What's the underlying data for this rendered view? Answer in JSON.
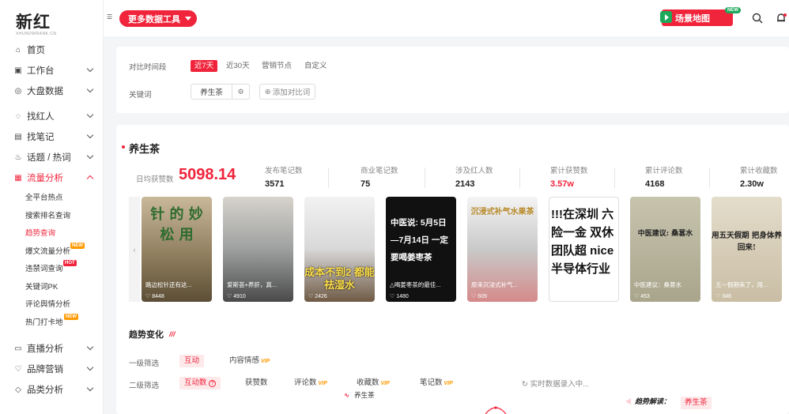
{
  "logo": {
    "main": "新红",
    "sub": "XHUNDWRANK.CN"
  },
  "sidebar": {
    "items": [
      {
        "label": "首页",
        "icon": "home-icon",
        "glyph": "⌂"
      },
      {
        "label": "工作台",
        "icon": "workbench-icon",
        "glyph": "▣"
      },
      {
        "label": "大盘数据",
        "icon": "dashboard-icon",
        "glyph": "◎"
      },
      {
        "label": "找红人",
        "icon": "search-people-icon",
        "glyph": "◌"
      },
      {
        "label": "找笔记",
        "icon": "notes-icon",
        "glyph": "▤"
      },
      {
        "label": "话题 / 热词",
        "icon": "fire-icon",
        "glyph": "♨"
      },
      {
        "label": "流量分析",
        "icon": "traffic-icon",
        "glyph": "▦"
      },
      {
        "label": "直播分析",
        "icon": "live-icon",
        "glyph": "▭"
      },
      {
        "label": "品牌营销",
        "icon": "brand-icon",
        "glyph": "♡"
      },
      {
        "label": "品类分析",
        "icon": "category-icon",
        "glyph": "◇"
      }
    ],
    "sub_items": [
      {
        "label": "全平台热点"
      },
      {
        "label": "搜索排名查询"
      },
      {
        "label": "趋势查询"
      },
      {
        "label": "爆文流量分析",
        "badge": "NEW"
      },
      {
        "label": "违禁词查询",
        "badge": "HOT"
      },
      {
        "label": "关键词PK"
      },
      {
        "label": "评论舆情分析"
      },
      {
        "label": "热门打卡地",
        "badge": "NEW"
      }
    ]
  },
  "topbar": {
    "collapse_glyph": "☰",
    "tools_label": "更多数据工具",
    "scene_label": "场景地图",
    "scene_badge": "NEW"
  },
  "filter": {
    "period_label": "对比时间段",
    "periods": [
      "近7天",
      "近30天",
      "营销节点",
      "自定义"
    ],
    "keyword_label": "关键词",
    "keyword": "养生茶",
    "add_compare": "添加对比词",
    "plus": "⊕",
    "gear": "⚙"
  },
  "summary": {
    "keyword": "养生茶",
    "avg_label": "日均获赞数",
    "avg_value": "5098.14",
    "stats": [
      {
        "label": "发布笔记数",
        "value": "3571"
      },
      {
        "label": "商业笔记数",
        "value": "75"
      },
      {
        "label": "涉及红人数",
        "value": "2143"
      },
      {
        "label": "累计获赞数",
        "value": "3.57w"
      },
      {
        "label": "累计评论数",
        "value": "4168"
      },
      {
        "label": "累计收藏数",
        "value": "2.30w"
      }
    ]
  },
  "notes": [
    {
      "text": "针 的 妙 松 用",
      "caption": "路边松针还有这...",
      "likes": "8448"
    },
    {
      "text": "",
      "caption": "爱斯荟+养肝，真...",
      "likes": "4910"
    },
    {
      "text": "成本不到2 都能祛湿水",
      "caption": "",
      "likes": "2426"
    },
    {
      "text": "中医说: 5月5日—7月14日 一定要喝姜枣茶",
      "caption": "△喝姜枣茶的最佳...",
      "likes": "1480"
    },
    {
      "text": "沉浸式补气水果茶",
      "caption": "原来沉浸式补气...",
      "likes": "609"
    },
    {
      "text": "!!!在深圳 六险一金 双休 团队超 nice 半导体行业",
      "caption": "",
      "likes": ""
    },
    {
      "text": "中医建议: 桑葚水",
      "caption": "中医建议：桑葚水",
      "likes": "453"
    },
    {
      "text": "用五天假期 把身体养回来!",
      "caption": "五一假期来了，用...",
      "likes": "348"
    }
  ],
  "trend": {
    "title": "趋势变化",
    "mark": "///",
    "level1_label": "一级筛选",
    "level1": [
      "互动",
      "内容情感"
    ],
    "level2_label": "二级筛选",
    "level2": [
      "互动数",
      "获赞数",
      "评论数",
      "收藏数",
      "笔记数"
    ],
    "vip": "VIP",
    "help": "?",
    "realtime": "实时数据录入中...",
    "legend": "养生茶",
    "legend_glyph": "∿",
    "interp_label": "趋势解读：",
    "interp_tag": "养生茶"
  }
}
